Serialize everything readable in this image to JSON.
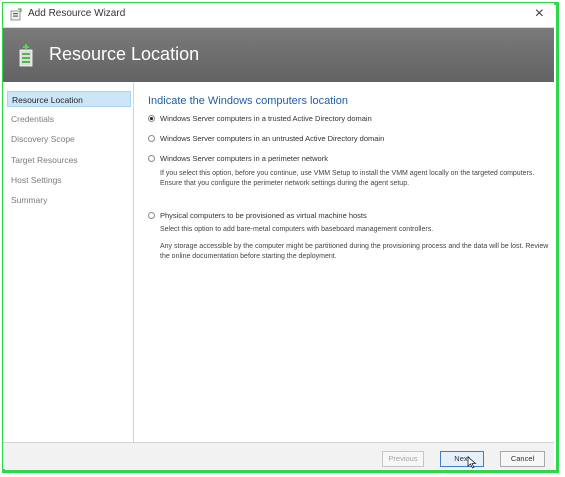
{
  "window": {
    "title": "Add Resource Wizard",
    "close_glyph": "×"
  },
  "header": {
    "title": "Resource Location",
    "icon": "wizard-resource-icon"
  },
  "nav": {
    "items": [
      {
        "label": "Resource Location",
        "active": true
      },
      {
        "label": "Credentials",
        "active": false
      },
      {
        "label": "Discovery Scope",
        "active": false
      },
      {
        "label": "Target Resources",
        "active": false
      },
      {
        "label": "Host Settings",
        "active": false
      },
      {
        "label": "Summary",
        "active": false
      }
    ]
  },
  "content": {
    "heading": "Indicate the Windows computers location",
    "options": [
      {
        "label": "Windows Server computers in a trusted Active Directory domain",
        "checked": true
      },
      {
        "label": "Windows Server computers in an untrusted Active Directory domain",
        "checked": false
      },
      {
        "label": "Windows Server computers in a perimeter network",
        "checked": false
      },
      {
        "label": "Physical computers to be provisioned as virtual machine hosts",
        "checked": false
      }
    ],
    "perimeter_desc": "If you select this option, before you continue, use VMM Setup to install the VMM agent locally on the targeted computers. Ensure that you configure the perimeter network settings during the agent setup.",
    "physical_desc_1": "Select this option to add bare-metal computers with baseboard management controllers.",
    "physical_desc_2": "Any storage accessible by the computer might be partitioned during the provisioning process and the data will be lost. Review the online documentation before starting the deployment."
  },
  "footer": {
    "previous_label": "Previous",
    "next_label": "Next",
    "cancel_label": "Cancel"
  },
  "colors": {
    "accent_border": "#2fd84a",
    "heading_blue": "#1e5fa8",
    "header_gray": "#6b6b6b",
    "nav_active": "#cde6f7"
  }
}
